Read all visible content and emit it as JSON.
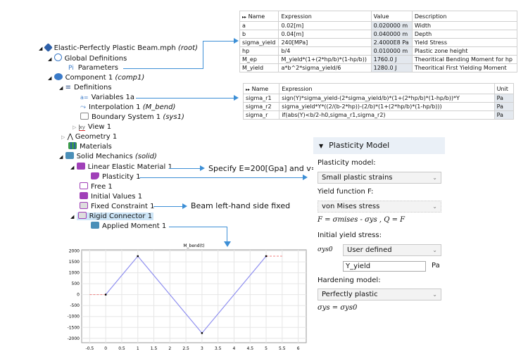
{
  "tree": {
    "root": {
      "label": "Elastic-Perfectly Plastic Beam.mph",
      "tag": "(root)"
    },
    "global_definitions": "Global Definitions",
    "parameters": "Parameters",
    "component": {
      "label": "Component 1",
      "tag": "(comp1)"
    },
    "definitions": "Definitions",
    "variables": "Variables 1a",
    "interpolation": {
      "label": "Interpolation 1",
      "tag": "(M_bend)"
    },
    "boundary_system": {
      "label": "Boundary System 1",
      "tag": "(sys1)"
    },
    "view": "View 1",
    "geometry": "Geometry 1",
    "materials": "Materials",
    "solid_mechanics": {
      "label": "Solid Mechanics",
      "tag": "(solid)"
    },
    "linear_elastic": "Linear Elastic Material 1",
    "plasticity": "Plasticity 1",
    "free": "Free 1",
    "initial_values": "Initial Values 1",
    "fixed_constraint": "Fixed Constraint 1",
    "rigid_connector": "Rigid Connector 1",
    "applied_moment": "Applied Moment 1"
  },
  "parameters_table": {
    "headers": [
      "Name",
      "Expression",
      "Value",
      "Description"
    ],
    "rows": [
      [
        "a",
        "0.02[m]",
        "0.020000 m",
        "Width"
      ],
      [
        "b",
        "0.04[m]",
        "0.040000 m",
        "Depth"
      ],
      [
        "sigma_yield",
        "240[MPa]",
        "2.4000E8 Pa",
        "Yield Stress"
      ],
      [
        "hp",
        "b/4",
        "0.010000 m",
        "Plastic zone height"
      ],
      [
        "M_ep",
        "M_yield*(1+(2*hp/b)*(1-hp/b))",
        "1760.0 J",
        "Theoritical Bending Moment for hp"
      ],
      [
        "M_yield",
        "a*b^2*sigma_yield/6",
        "1280.0 J",
        "Theoritical First Yielding Moment"
      ]
    ]
  },
  "variables_table": {
    "headers": [
      "Name",
      "Expression",
      "Unit"
    ],
    "rows": [
      [
        "sigma_r1",
        "sign(Y)*sigma_yield-(2*sigma_yield/b)*(1+(2*hp/b)*(1-hp/b))*Y",
        "Pa"
      ],
      [
        "sigma_r2",
        "sigma_yield*Y*((2/(b-2*hp))-(2/b)*(1+(2*hp/b)*(1-hp/b)))",
        "Pa"
      ],
      [
        "sigma_r",
        "if(abs(Y)<b/2-h0,sigma_r1,sigma_r2)",
        "Pa"
      ]
    ]
  },
  "annotations": {
    "material": "Specify E=200[Gpa] and v=0",
    "fixed": "Beam left-hand side fixed"
  },
  "plasticity_panel": {
    "title": "Plasticity Model",
    "plasticity_model_label": "Plasticity model:",
    "plasticity_model_value": "Small plastic strains",
    "yield_function_label": "Yield function F:",
    "yield_function_value": "von Mises stress",
    "yield_formula": "F = σmises - σys ,   Q = F",
    "initial_yield_label": "Initial yield stress:",
    "sigma_ys0_symbol": "σys0",
    "initial_yield_source": "User defined",
    "initial_yield_value": "Y_yield",
    "initial_yield_unit": "Pa",
    "hardening_label": "Hardening model:",
    "hardening_value": "Perfectly plastic",
    "hardening_formula": "σys = σys0"
  },
  "chart_data": {
    "type": "line",
    "title": "M_bend(t)",
    "xlabel": "",
    "ylabel": "",
    "xlim": [
      -0.75,
      6.25
    ],
    "ylim": [
      -2200,
      2050
    ],
    "xticks": [
      "-0.5",
      "0",
      "0.5",
      "1",
      "1.5",
      "2",
      "2.5",
      "3",
      "3.5",
      "4",
      "4.5",
      "5",
      "5.5",
      "6"
    ],
    "yticks": [
      "2000",
      "1500",
      "1000",
      "500",
      "0",
      "-500",
      "-1000",
      "-1500",
      "-2000"
    ],
    "grid": true,
    "series": [
      {
        "x": [
          0,
          1,
          3,
          5
        ],
        "y": [
          0,
          1760,
          -1760,
          1760
        ],
        "color": "#8f8ff0"
      }
    ],
    "extrapolation": [
      {
        "x": [
          -0.5,
          0
        ],
        "y": [
          0,
          0
        ]
      },
      {
        "x": [
          5,
          5.5
        ],
        "y": [
          1760,
          1760
        ]
      }
    ],
    "extrapolation_color": "#f08080"
  }
}
